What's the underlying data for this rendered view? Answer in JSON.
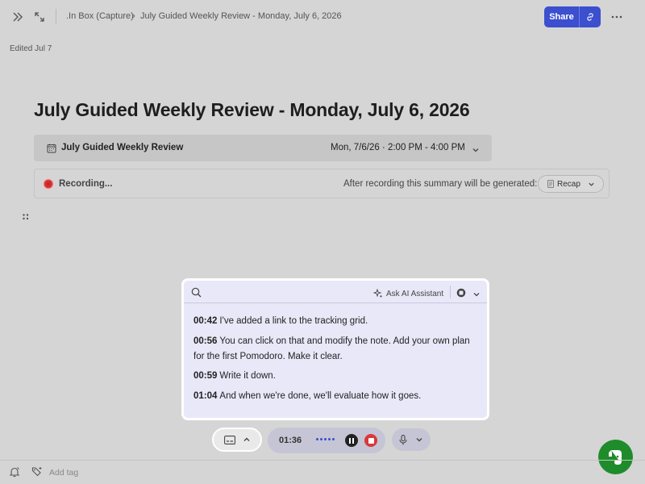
{
  "breadcrumb": {
    "folder": ".In Box (Capture)",
    "separator": "›",
    "note": "July Guided Weekly Review - Monday, July 6, 2026"
  },
  "toolbar": {
    "share_label": "Share",
    "icons": [
      "expand-sidebar-icon",
      "fullscreen-icon",
      "link-icon",
      "more-icon"
    ]
  },
  "note": {
    "edited": "Edited Jul 7",
    "title": "July Guided Weekly Review - Monday, July 6, 2026"
  },
  "event": {
    "name": "July Guided Weekly Review",
    "time": "Mon, 7/6/26 · 2:00 PM - 4:00 PM"
  },
  "recording": {
    "status": "Recording...",
    "after_text": "After recording this summary will be generated:",
    "summary_option": "Recap"
  },
  "transcript": {
    "ask_ai": "Ask AI Assistant",
    "lines": [
      {
        "time": "00:42",
        "text": "I've added a link to the tracking grid."
      },
      {
        "time": "00:56",
        "text": "You can click on that and modify the note. Add your own plan for the first Pomodoro. Make it clear."
      },
      {
        "time": "00:59",
        "text": "Write it down."
      },
      {
        "time": "01:04",
        "text": "And when we're done, we'll evaluate how it goes."
      }
    ]
  },
  "controls": {
    "elapsed": "01:36"
  },
  "footer": {
    "add_tag": "Add tag"
  },
  "colors": {
    "accent": "#3b4fcf",
    "record_red": "#d9383a",
    "evernote_green": "#1e8c2a",
    "panel_bg": "#e8e8f8"
  }
}
